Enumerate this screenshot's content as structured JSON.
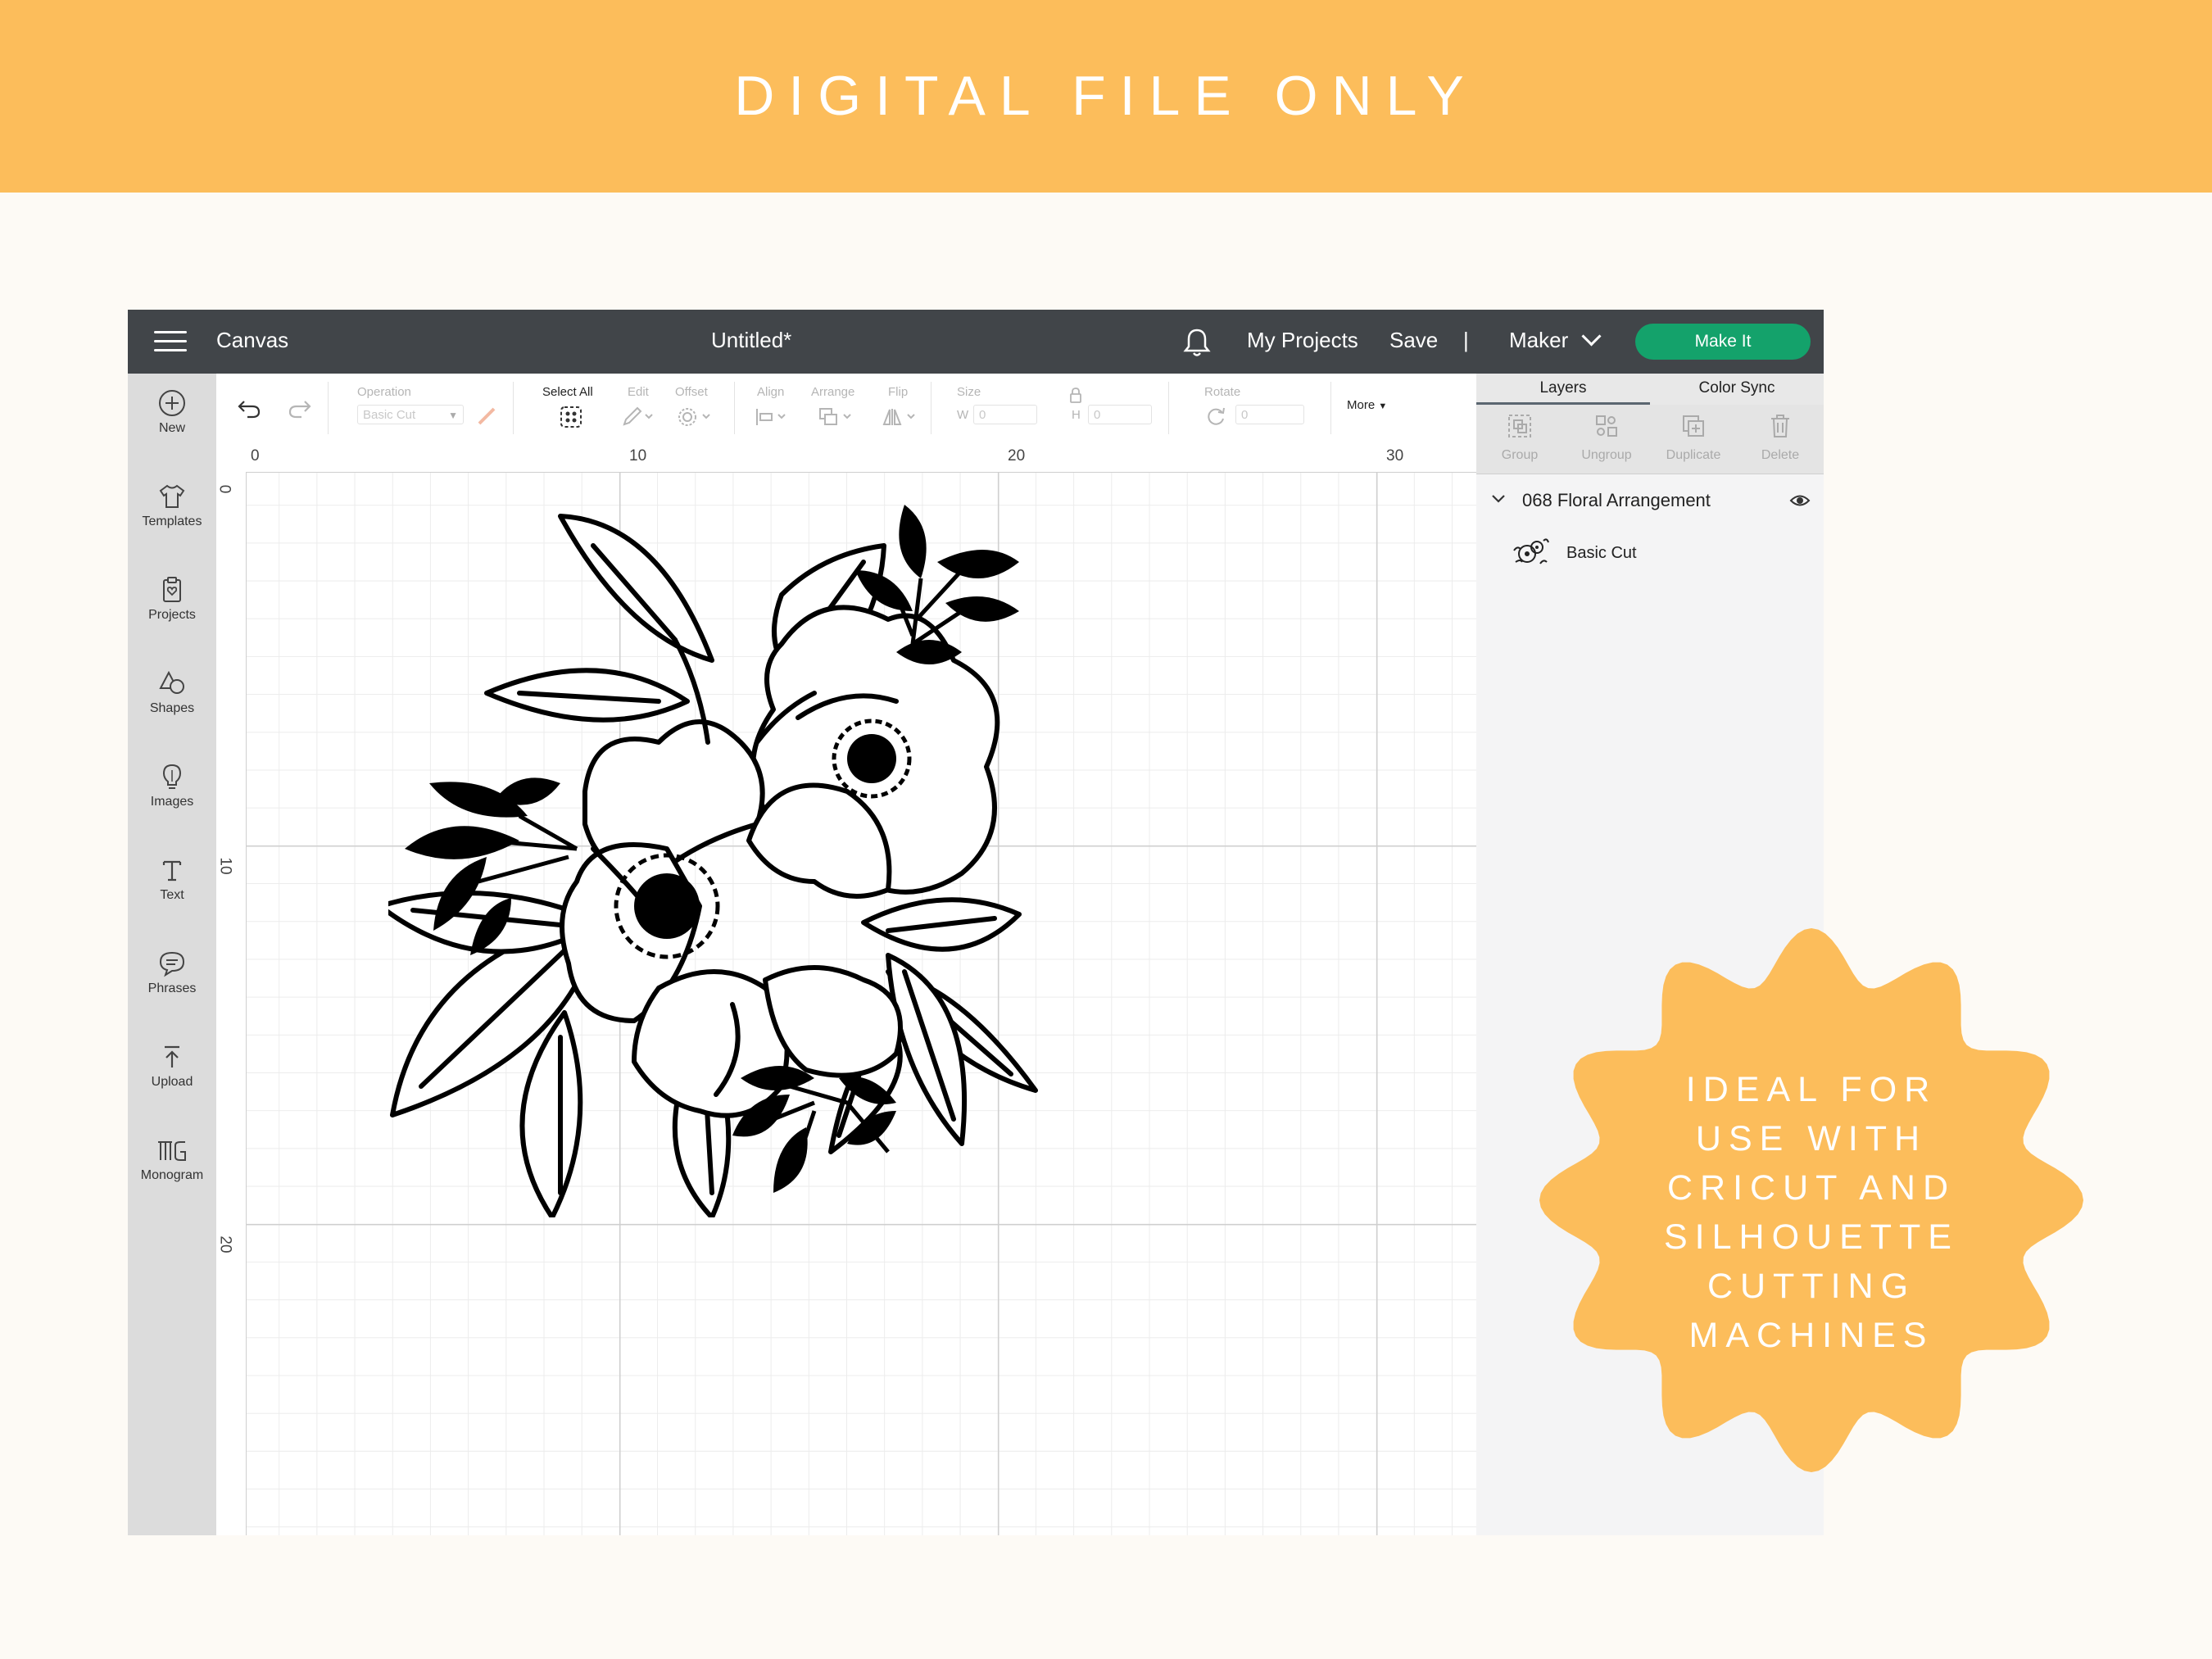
{
  "banner": {
    "title": "DIGITAL FILE ONLY"
  },
  "topbar": {
    "app_section": "Canvas",
    "document_title": "Untitled*",
    "my_projects": "My Projects",
    "save": "Save",
    "divider": "|",
    "machine": "Maker",
    "make_it": "Make It"
  },
  "sidebar": {
    "items": [
      {
        "label": "New",
        "icon": "plus-circle-icon"
      },
      {
        "label": "Templates",
        "icon": "shirt-icon"
      },
      {
        "label": "Projects",
        "icon": "clipboard-heart-icon"
      },
      {
        "label": "Shapes",
        "icon": "shapes-icon"
      },
      {
        "label": "Images",
        "icon": "lightbulb-icon"
      },
      {
        "label": "Text",
        "icon": "text-T-icon"
      },
      {
        "label": "Phrases",
        "icon": "speech-bubble-icon"
      },
      {
        "label": "Upload",
        "icon": "upload-arrow-icon"
      },
      {
        "label": "Monogram",
        "icon": "monogram-icon"
      }
    ]
  },
  "toolbar": {
    "operation_label": "Operation",
    "operation_value": "Basic Cut",
    "select_all": "Select All",
    "edit": "Edit",
    "offset": "Offset",
    "align": "Align",
    "arrange": "Arrange",
    "flip": "Flip",
    "size": "Size",
    "w_label": "W",
    "w_value": "0",
    "h_label": "H",
    "h_value": "0",
    "rotate": "Rotate",
    "rotate_value": "0",
    "more": "More"
  },
  "panel": {
    "tabs": [
      "Layers",
      "Color Sync"
    ],
    "actions": [
      "Group",
      "Ungroup",
      "Duplicate",
      "Delete"
    ],
    "layer_group": "068 Floral Arrangement",
    "layer_item": "Basic Cut"
  },
  "rulers": {
    "top": [
      "0",
      "10",
      "20",
      "30"
    ],
    "left": [
      "0",
      "10",
      "20"
    ]
  },
  "badge": {
    "lines": [
      "IDEAL FOR",
      "USE WITH",
      "CRICUT AND",
      "SILHOUETTE",
      "CUTTING",
      "MACHINES"
    ],
    "color": "#fcbd5b"
  },
  "colors": {
    "banner": "#fcbd5b",
    "topbar": "#414549",
    "make_it": "#14a26b",
    "background": "#fdfaf5"
  }
}
